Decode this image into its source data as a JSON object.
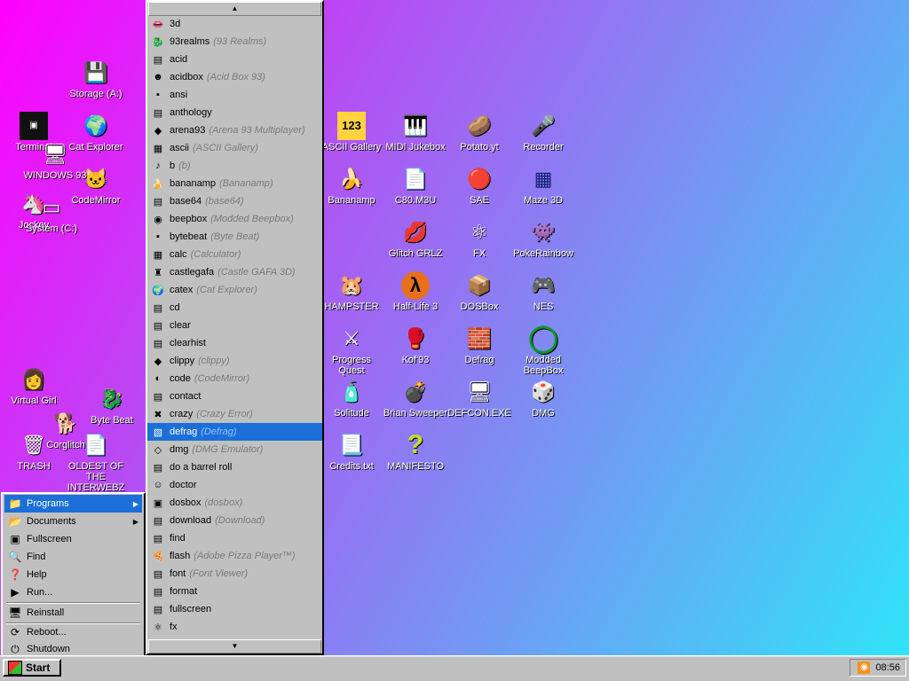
{
  "desktop_icons": [
    {
      "label": "Storage (A:)",
      "icon": "floppy-drive-icon",
      "glyph": "💾"
    },
    {
      "label": "Terminal",
      "icon": "terminal-icon",
      "glyph": "▣"
    },
    {
      "label": "Cat Explorer",
      "icon": "cat-globe-icon",
      "glyph": "🌍"
    },
    {
      "label": "WINDOWS 93",
      "icon": "computer-icon",
      "glyph": "🖥"
    },
    {
      "label": "Jockey",
      "icon": "jockey-icon",
      "glyph": "🦄"
    },
    {
      "label": "CodeMirror",
      "icon": "codemirror-icon",
      "glyph": "🐱"
    },
    {
      "label": "System (C:)",
      "icon": "hard-drive-icon",
      "glyph": "▭"
    },
    {
      "label": "Virtual Girl",
      "icon": "virtual-girl-icon",
      "glyph": "👩"
    },
    {
      "label": "Byte Beat",
      "icon": "bytebeat-icon",
      "glyph": "🐉"
    },
    {
      "label": "Corglitch",
      "icon": "corgi-icon",
      "glyph": "🐕"
    },
    {
      "label": "TRASH",
      "icon": "trash-icon",
      "glyph": "🗑"
    },
    {
      "label": "OLDEST OF THE INTERWEBZ",
      "icon": "oldest-icon",
      "glyph": "📄"
    },
    {
      "label": "ASCII Gallery",
      "icon": "ascii-gallery-icon",
      "glyph": "123"
    },
    {
      "label": "MIDI Jukebox",
      "icon": "piano-icon",
      "glyph": "🎹"
    },
    {
      "label": "Potato.yt",
      "icon": "potato-icon",
      "glyph": "🥔"
    },
    {
      "label": "Recorder",
      "icon": "microphone-icon",
      "glyph": "🎤"
    },
    {
      "label": "Bananamp",
      "icon": "banana-icon",
      "glyph": "🍌"
    },
    {
      "label": "C80.M3U",
      "icon": "playlist-file-icon",
      "glyph": "📄"
    },
    {
      "label": "SAE",
      "icon": "amiga-ball-icon",
      "glyph": "🔴"
    },
    {
      "label": "Maze 3D",
      "icon": "maze-icon",
      "glyph": "▦"
    },
    {
      "label": "Glitch GRLZ",
      "icon": "lips-icon",
      "glyph": "💋"
    },
    {
      "label": "FX",
      "icon": "atom-icon",
      "glyph": "⚛"
    },
    {
      "label": "PokeRainbow",
      "icon": "pokerainbow-icon",
      "glyph": "👾"
    },
    {
      "label": "HAMPSTER",
      "icon": "hamster-icon",
      "glyph": "🐹"
    },
    {
      "label": "Half-Life 3",
      "icon": "lambda-icon",
      "glyph": "λ"
    },
    {
      "label": "DOSBox",
      "icon": "dosbox-icon",
      "glyph": "📦"
    },
    {
      "label": "NES",
      "icon": "nes-console-icon",
      "glyph": "🎮"
    },
    {
      "label": "Progress Quest",
      "icon": "swords-icon",
      "glyph": "⚔"
    },
    {
      "label": "Kof'93",
      "icon": "fighter-icon",
      "glyph": "🥊"
    },
    {
      "label": "Defrag",
      "icon": "defrag-icon",
      "glyph": "🧱"
    },
    {
      "label": "Modded BeepBox",
      "icon": "beepbox-ring-icon",
      "glyph": "◯"
    },
    {
      "label": "Solitude",
      "icon": "bottle-icon",
      "glyph": "🧴"
    },
    {
      "label": "Brian Sweeper",
      "icon": "mine-icon",
      "glyph": "💣"
    },
    {
      "label": "DEFCON.EXE",
      "icon": "defcon-monitor-icon",
      "glyph": "🖥"
    },
    {
      "label": "DMG",
      "icon": "dmg-icon",
      "glyph": "🎲"
    },
    {
      "label": "Credits.txt",
      "icon": "text-file-icon",
      "glyph": "📃"
    },
    {
      "label": "MANIFESTO",
      "icon": "question-icon",
      "glyph": "?"
    }
  ],
  "start_menu": {
    "items": [
      {
        "label": "Programs",
        "icon": "programs-icon",
        "glyph": "📁",
        "submenu": true,
        "active": true
      },
      {
        "label": "Documents",
        "icon": "documents-icon",
        "glyph": "📂",
        "submenu": true
      },
      {
        "label": "Fullscreen",
        "icon": "fullscreen-icon",
        "glyph": "▣"
      },
      {
        "label": "Find",
        "icon": "find-icon",
        "glyph": "🔍"
      },
      {
        "label": "Help",
        "icon": "help-icon",
        "glyph": "❓"
      },
      {
        "label": "Run...",
        "icon": "run-icon",
        "glyph": "▶"
      },
      {
        "label": "Reinstall",
        "icon": "reinstall-icon",
        "glyph": "🖥"
      },
      {
        "label": "Reboot...",
        "icon": "reboot-icon",
        "glyph": "⟳"
      },
      {
        "label": "Shutdown",
        "icon": "shutdown-icon",
        "glyph": "⏻"
      }
    ]
  },
  "programs_menu": {
    "items": [
      {
        "name": "3d",
        "alt": "",
        "glyph": "👄",
        "icon": "3d-icon"
      },
      {
        "name": "93realms",
        "alt": "(93 Realms)",
        "glyph": "🐉",
        "icon": "93realms-icon"
      },
      {
        "name": "acid",
        "alt": "",
        "glyph": "▤",
        "icon": "acid-icon"
      },
      {
        "name": "acidbox",
        "alt": "(Acid Box 93)",
        "glyph": "☻",
        "icon": "acidbox-icon"
      },
      {
        "name": "ansi",
        "alt": "",
        "glyph": "▪",
        "icon": "ansi-icon"
      },
      {
        "name": "anthology",
        "alt": "",
        "glyph": "▤",
        "icon": "anthology-icon"
      },
      {
        "name": "arena93",
        "alt": "(Arena 93 Multiplayer)",
        "glyph": "◆",
        "icon": "arena93-icon"
      },
      {
        "name": "ascii",
        "alt": "(ASCII Gallery)",
        "glyph": "▦",
        "icon": "ascii-icon"
      },
      {
        "name": "b",
        "alt": "(b)",
        "glyph": "♪",
        "icon": "b-icon"
      },
      {
        "name": "bananamp",
        "alt": "(Bananamp)",
        "glyph": "🍌",
        "icon": "bananamp-icon"
      },
      {
        "name": "base64",
        "alt": "(base64)",
        "glyph": "▤",
        "icon": "base64-icon"
      },
      {
        "name": "beepbox",
        "alt": "(Modded Beepbox)",
        "glyph": "◉",
        "icon": "beepbox-icon"
      },
      {
        "name": "bytebeat",
        "alt": "(Byte Beat)",
        "glyph": "▪",
        "icon": "bytebeat-icon"
      },
      {
        "name": "calc",
        "alt": "(Calculator)",
        "glyph": "▦",
        "icon": "calc-icon"
      },
      {
        "name": "castlegafa",
        "alt": "(Castle GAFA 3D)",
        "glyph": "♜",
        "icon": "castlegafa-icon"
      },
      {
        "name": "catex",
        "alt": "(Cat Explorer)",
        "glyph": "🌍",
        "icon": "catex-icon"
      },
      {
        "name": "cd",
        "alt": "",
        "glyph": "▤",
        "icon": "cd-icon"
      },
      {
        "name": "clear",
        "alt": "",
        "glyph": "▤",
        "icon": "clear-icon"
      },
      {
        "name": "clearhist",
        "alt": "",
        "glyph": "▤",
        "icon": "clearhist-icon"
      },
      {
        "name": "clippy",
        "alt": "(clippy)",
        "glyph": "◆",
        "icon": "clippy-icon"
      },
      {
        "name": "code",
        "alt": "(CodeMirror)",
        "glyph": "◐",
        "icon": "code-icon"
      },
      {
        "name": "contact",
        "alt": "",
        "glyph": "▤",
        "icon": "contact-icon"
      },
      {
        "name": "crazy",
        "alt": "(Crazy Error)",
        "glyph": "✖",
        "icon": "crazy-icon"
      },
      {
        "name": "defrag",
        "alt": "(Defrag)",
        "glyph": "▧",
        "icon": "defrag-icon",
        "active": true
      },
      {
        "name": "dmg",
        "alt": "(DMG Emulator)",
        "glyph": "◇",
        "icon": "dmg-icon"
      },
      {
        "name": "do a barrel roll",
        "alt": "",
        "glyph": "▤",
        "icon": "barrel-roll-icon"
      },
      {
        "name": "doctor",
        "alt": "",
        "glyph": "☺",
        "icon": "doctor-icon"
      },
      {
        "name": "dosbox",
        "alt": "(dosbox)",
        "glyph": "▣",
        "icon": "dosbox-icon"
      },
      {
        "name": "download",
        "alt": "(Download)",
        "glyph": "▤",
        "icon": "download-icon"
      },
      {
        "name": "find",
        "alt": "",
        "glyph": "▤",
        "icon": "find-icon"
      },
      {
        "name": "flash",
        "alt": "(Adobe Pizza Player™)",
        "glyph": "🍕",
        "icon": "flash-icon"
      },
      {
        "name": "font",
        "alt": "(Font Viewer)",
        "glyph": "▤",
        "icon": "font-icon"
      },
      {
        "name": "format",
        "alt": "",
        "glyph": "▤",
        "icon": "format-icon"
      },
      {
        "name": "fullscreen",
        "alt": "",
        "glyph": "▤",
        "icon": "fullscreen-icon"
      },
      {
        "name": "fx",
        "alt": "",
        "glyph": "⚛",
        "icon": "fx-icon"
      }
    ]
  },
  "taskbar": {
    "start_label": "Start",
    "clock": "08:56"
  }
}
